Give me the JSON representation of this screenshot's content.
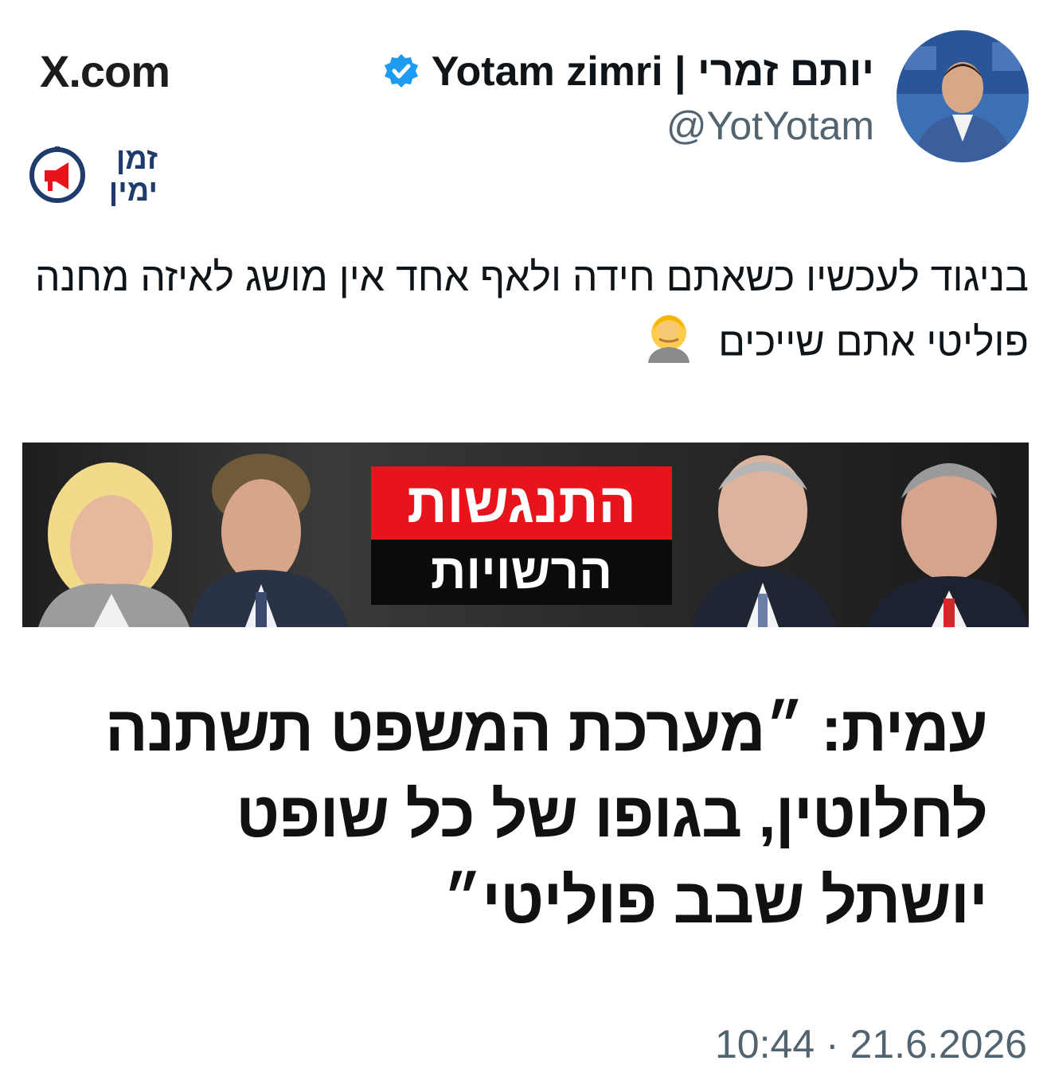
{
  "site": {
    "label": "X.com"
  },
  "brand_logo": {
    "line1": "זמן",
    "line2": "ימין"
  },
  "author": {
    "display_name": "יותם זמרי | Yotam zimri",
    "handle": "@YotYotam",
    "verified": true
  },
  "tweet": {
    "text": "בניגוד לעכשיו כשאתם חידה ולאף אחד אין מושג לאיזה מחנה פוליטי אתם שייכים",
    "emoji": "face-palm-icon"
  },
  "image": {
    "banner_top": "התנגשות",
    "banner_bottom": "הרשויות",
    "quote_lines": [
      "עמית: ״מערכת המשפט תשתנה",
      "לחלוטין, בגופו של כל שופט",
      "יושתל שבב פוליטי״"
    ]
  },
  "timestamp": "10:44 · 21.6.2026",
  "colors": {
    "verified_blue": "#1d9bf0",
    "banner_red": "#e8141c",
    "secondary_text": "#536471"
  }
}
